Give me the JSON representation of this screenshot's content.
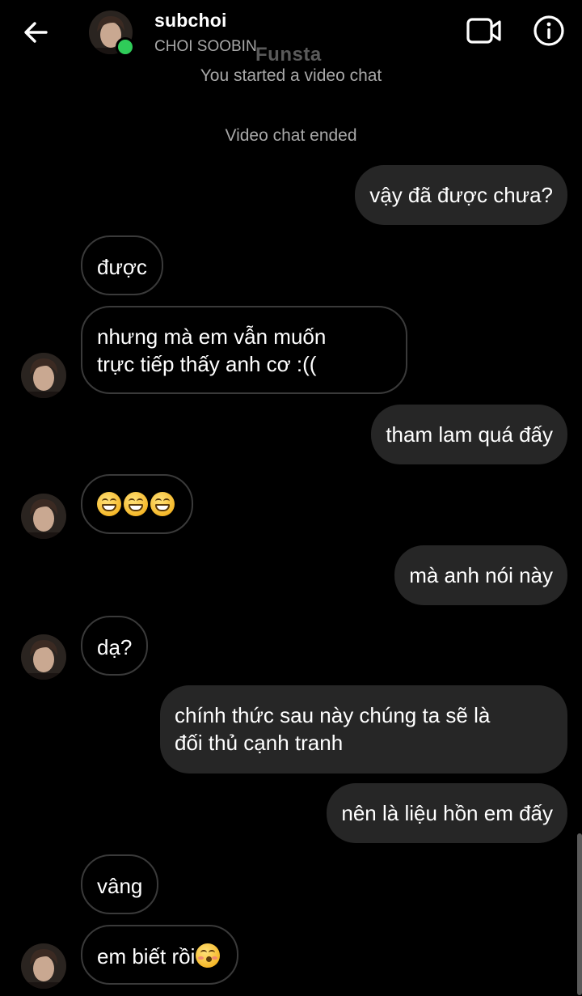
{
  "header": {
    "name": "subchoi",
    "subtitle": "CHOI SOOBIN",
    "watermark": "Funsta",
    "icons": {
      "back": "arrow-left-icon",
      "video": "video-camera-icon",
      "info": "info-circle-icon"
    },
    "online_color": "#2fcc59"
  },
  "system": {
    "video_started": "You started a video chat",
    "video_ended": "Video chat ended"
  },
  "messages": [
    {
      "side": "sent",
      "text": "vậy đã được chưa?"
    },
    {
      "side": "recv",
      "text": "được"
    },
    {
      "side": "recv",
      "lines": [
        "nhưng mà em vẫn muốn",
        "trực tiếp thấy anh cơ :(("
      ]
    },
    {
      "side": "sent",
      "text": "tham lam quá đấy"
    },
    {
      "side": "recv",
      "emoji": "grinning-face-with-smiling-eyes",
      "emoji_count": 3
    },
    {
      "side": "sent",
      "text": "mà anh nói này"
    },
    {
      "side": "recv",
      "text": "dạ?"
    },
    {
      "side": "sent",
      "lines": [
        "chính thức sau này chúng ta sẽ là",
        "đối thủ cạnh tranh"
      ]
    },
    {
      "side": "sent",
      "text": "nên là liệu hồn em đấy"
    },
    {
      "side": "recv",
      "text": "vâng"
    },
    {
      "side": "recv",
      "text": "em biết rồi",
      "emoji": "kissing-face-with-closed-eyes"
    }
  ],
  "colors": {
    "background": "#000000",
    "sent_bubble": "#262626",
    "recv_border": "#3a3a3a",
    "secondary_text": "#a8a8a8"
  }
}
